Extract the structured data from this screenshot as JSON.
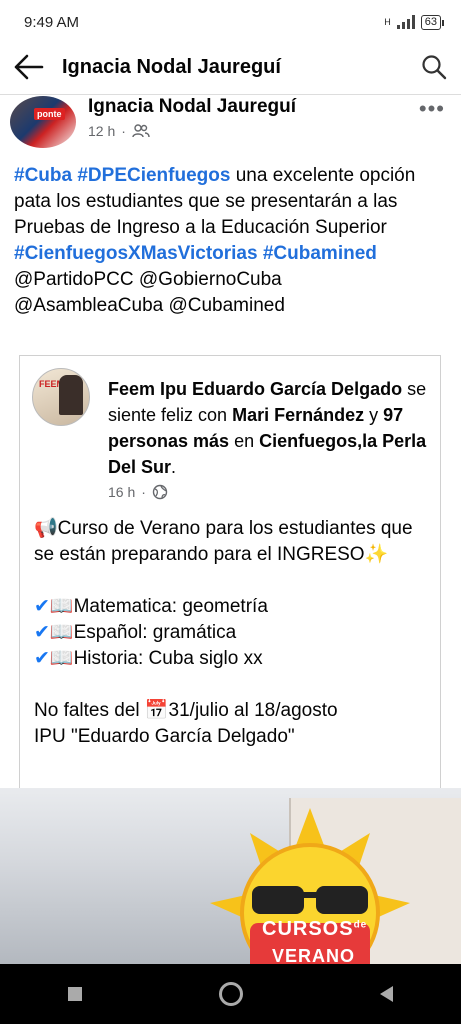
{
  "status": {
    "time": "9:49 AM",
    "network": "H",
    "battery": "63"
  },
  "app_bar": {
    "title": "Ignacia Nodal Jaureguí"
  },
  "post": {
    "author": "Ignacia Nodal Jaureguí",
    "time": "12 h",
    "avatar_text": "ponte",
    "text": {
      "hashtag1": "#Cuba",
      "hashtag2": "#DPECienfuegos",
      "body": " una excelente opción pata los estudiantes que se presentarán a las Pruebas de Ingreso a la Educación Superior",
      "hashtag3": "#CienfuegosXMasVictorias",
      "hashtag4": "#Cubamined",
      "mentions1": "@PartidoPCC @GobiernoCuba",
      "mentions2": "@AsambleaCuba @Cubamined"
    }
  },
  "shared": {
    "avatar_text": "FEEM",
    "name": "Feem Ipu Eduardo García Delgado",
    "feeling": " se siente feliz con ",
    "person1": "Mari Fernández",
    "and": " y ",
    "others": "97 personas más",
    "in": " en ",
    "place": "Cienfuegos,la Perla Del Sur",
    "period": ".",
    "time": "16 h",
    "line1": "📢Curso de Verano para los estudiantes que se están preparando para el INGRESO✨",
    "item1": "📖Matematica: geometría",
    "item2": "📖Español: gramática",
    "item3": "📖Historia: Cuba siglo  xx",
    "line2": "No faltes del 📅31/julio  al  18/agosto",
    "line3": "IPU \"Eduardo García Delgado\""
  },
  "photo": {
    "banner_line1": "CURSOS",
    "banner_de": "de",
    "banner_line2": "VERANO"
  },
  "colors": {
    "link": "#216fdb",
    "check": "#1877f2",
    "meta": "#65676b"
  },
  "icons": [
    "back-arrow-icon",
    "search-icon",
    "more-icon",
    "friends-icon",
    "globe-icon",
    "check-icon"
  ]
}
